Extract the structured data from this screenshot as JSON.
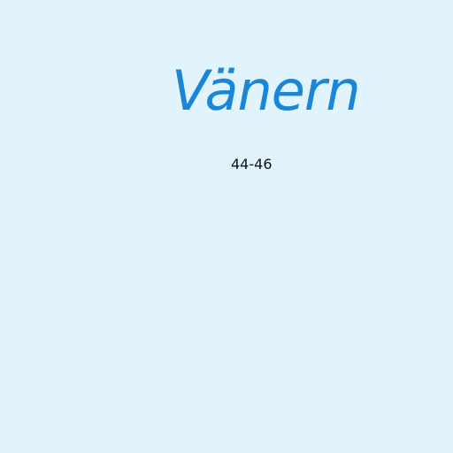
{
  "map": {
    "water_name": "Vänern",
    "depth_label": "44-46",
    "colors": {
      "water": "#e1f4fe",
      "water_label": "#1a86d8",
      "depth_label": "#111111"
    }
  }
}
